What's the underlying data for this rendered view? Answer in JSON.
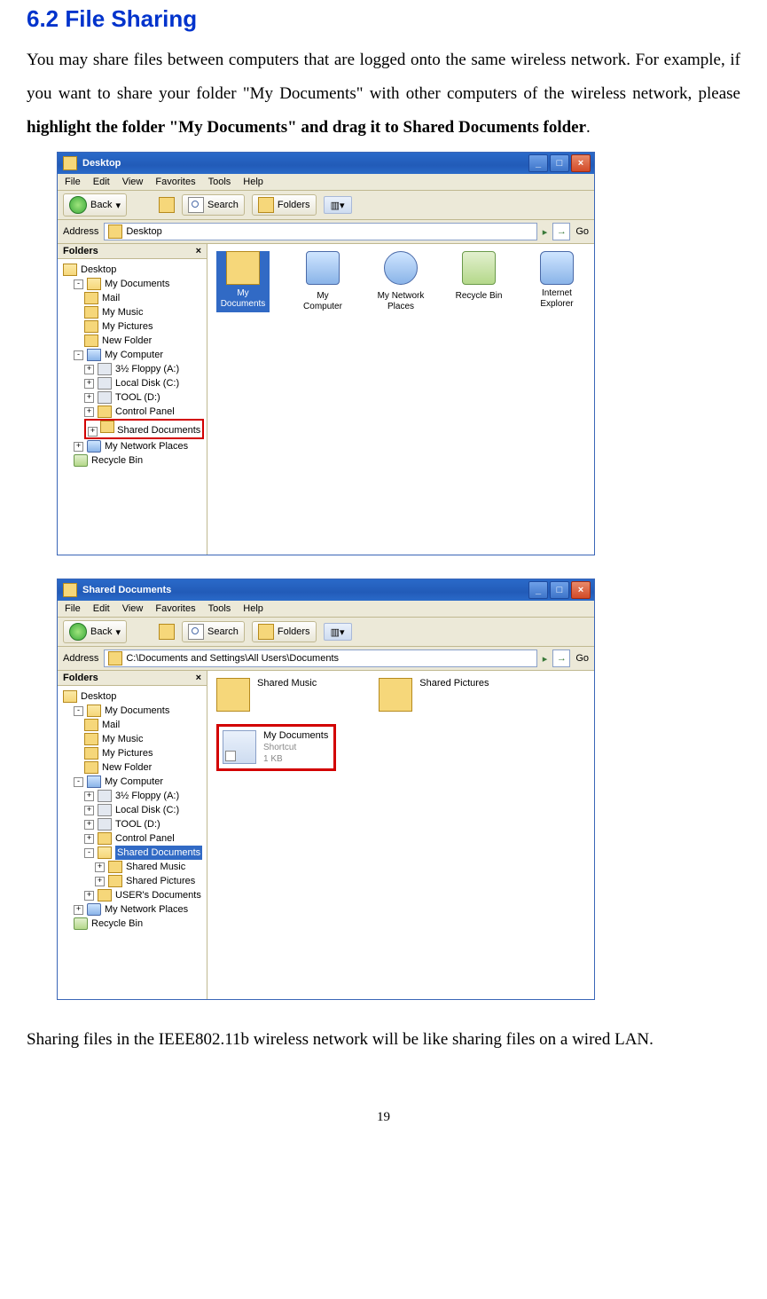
{
  "heading": "6.2 File Sharing",
  "para1_a": "You may share files between computers that are logged onto the same wireless network. For example, if you want to share your folder \"My Documents\" with other computers of the wireless network, please ",
  "para1_b": "highlight the folder \"My Documents\" and drag it to Shared Documents folder",
  "para1_c": ".",
  "para2": "Sharing files in the IEEE802.11b wireless network will be like sharing files on a wired LAN.",
  "page_number": "19",
  "win1": {
    "title": "Desktop",
    "menu": [
      "File",
      "Edit",
      "View",
      "Favorites",
      "Tools",
      "Help"
    ],
    "toolbar": {
      "back": "Back",
      "search": "Search",
      "folders": "Folders"
    },
    "addr_label": "Address",
    "addr_value": "Desktop",
    "go": "Go",
    "folders_title": "Folders",
    "tree": {
      "n0": "Desktop",
      "n1": "My Documents",
      "n1a": "Mail",
      "n1b": "My Music",
      "n1c": "My Pictures",
      "n1d": "New Folder",
      "n2": "My Computer",
      "n2a": "3½ Floppy (A:)",
      "n2b": "Local Disk (C:)",
      "n2c": "TOOL (D:)",
      "n2d": "Control Panel",
      "n2e": "Shared Documents",
      "n3": "My Network Places",
      "n4": "Recycle Bin"
    },
    "icons": {
      "mydocs": "My Documents",
      "mycomp": "My Computer",
      "mynet": "My Network Places",
      "recycle": "Recycle Bin",
      "ie": "Internet Explorer"
    }
  },
  "win2": {
    "title": "Shared Documents",
    "menu": [
      "File",
      "Edit",
      "View",
      "Favorites",
      "Tools",
      "Help"
    ],
    "toolbar": {
      "back": "Back",
      "search": "Search",
      "folders": "Folders"
    },
    "addr_label": "Address",
    "addr_value": "C:\\Documents and Settings\\All Users\\Documents",
    "go": "Go",
    "folders_title": "Folders",
    "tree": {
      "n0": "Desktop",
      "n1": "My Documents",
      "n1a": "Mail",
      "n1b": "My Music",
      "n1c": "My Pictures",
      "n1d": "New Folder",
      "n2": "My Computer",
      "n2a": "3½ Floppy (A:)",
      "n2b": "Local Disk (C:)",
      "n2c": "TOOL (D:)",
      "n2d": "Control Panel",
      "n2e": "Shared Documents",
      "n2e1": "Shared Music",
      "n2e2": "Shared Pictures",
      "n2f": "USER's Documents",
      "n3": "My Network Places",
      "n4": "Recycle Bin"
    },
    "tiles": {
      "sm": "Shared Music",
      "sp": "Shared Pictures",
      "mydocs": "My Documents",
      "shortcut": "Shortcut",
      "size": "1 KB"
    }
  }
}
